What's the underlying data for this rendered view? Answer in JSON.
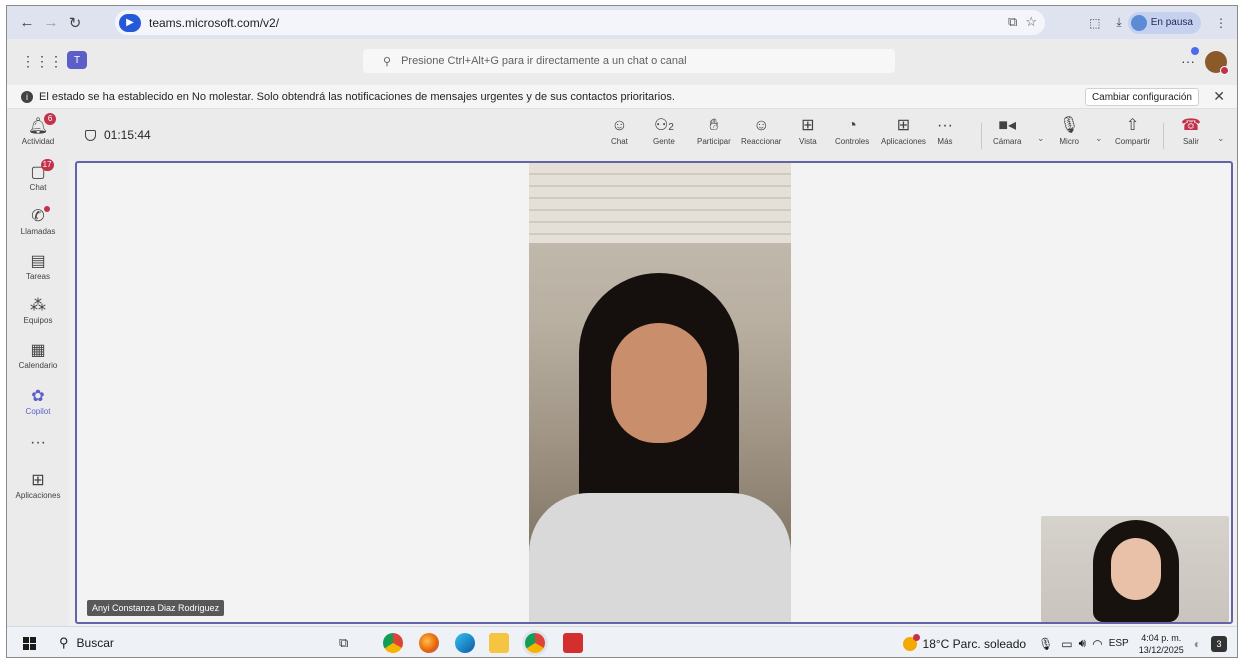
{
  "browser": {
    "url": "teams.microsoft.com/v2/",
    "profile_status": "En pausa"
  },
  "teams": {
    "search_placeholder": "Presione Ctrl+Alt+G para ir directamente a un chat o canal"
  },
  "banner": {
    "message": "El estado se ha establecido en No molestar. Solo obtendrá las notificaciones de mensajes urgentes y de sus contactos prioritarios.",
    "button": "Cambiar configuración"
  },
  "rail": {
    "items": [
      {
        "label": "Actividad",
        "badge": "6"
      },
      {
        "label": "Chat",
        "badge": "17"
      },
      {
        "label": "Llamadas"
      },
      {
        "label": "Tareas"
      },
      {
        "label": "Equipos"
      },
      {
        "label": "Calendario"
      },
      {
        "label": "Copilot"
      },
      {
        "label": "Aplicaciones"
      }
    ]
  },
  "meeting": {
    "timer": "01:15:44",
    "people_count": "2",
    "buttons": {
      "chat": "Chat",
      "people": "Gente",
      "raise": "Participar",
      "react": "Reaccionar",
      "view": "Vista",
      "controls": "Controles",
      "apps": "Aplicaciones",
      "more": "Más",
      "camera": "Cámara",
      "mic": "Micro",
      "share": "Compartir",
      "leave": "Salir"
    },
    "participant_name": "Anyi Constanza Diaz Rodriguez"
  },
  "taskbar": {
    "search_label": "Buscar",
    "weather": "18°C Parc. soleado",
    "language": "ESP",
    "time": "4:04 p. m.",
    "date": "13/12/2025",
    "notification_count": "3"
  }
}
